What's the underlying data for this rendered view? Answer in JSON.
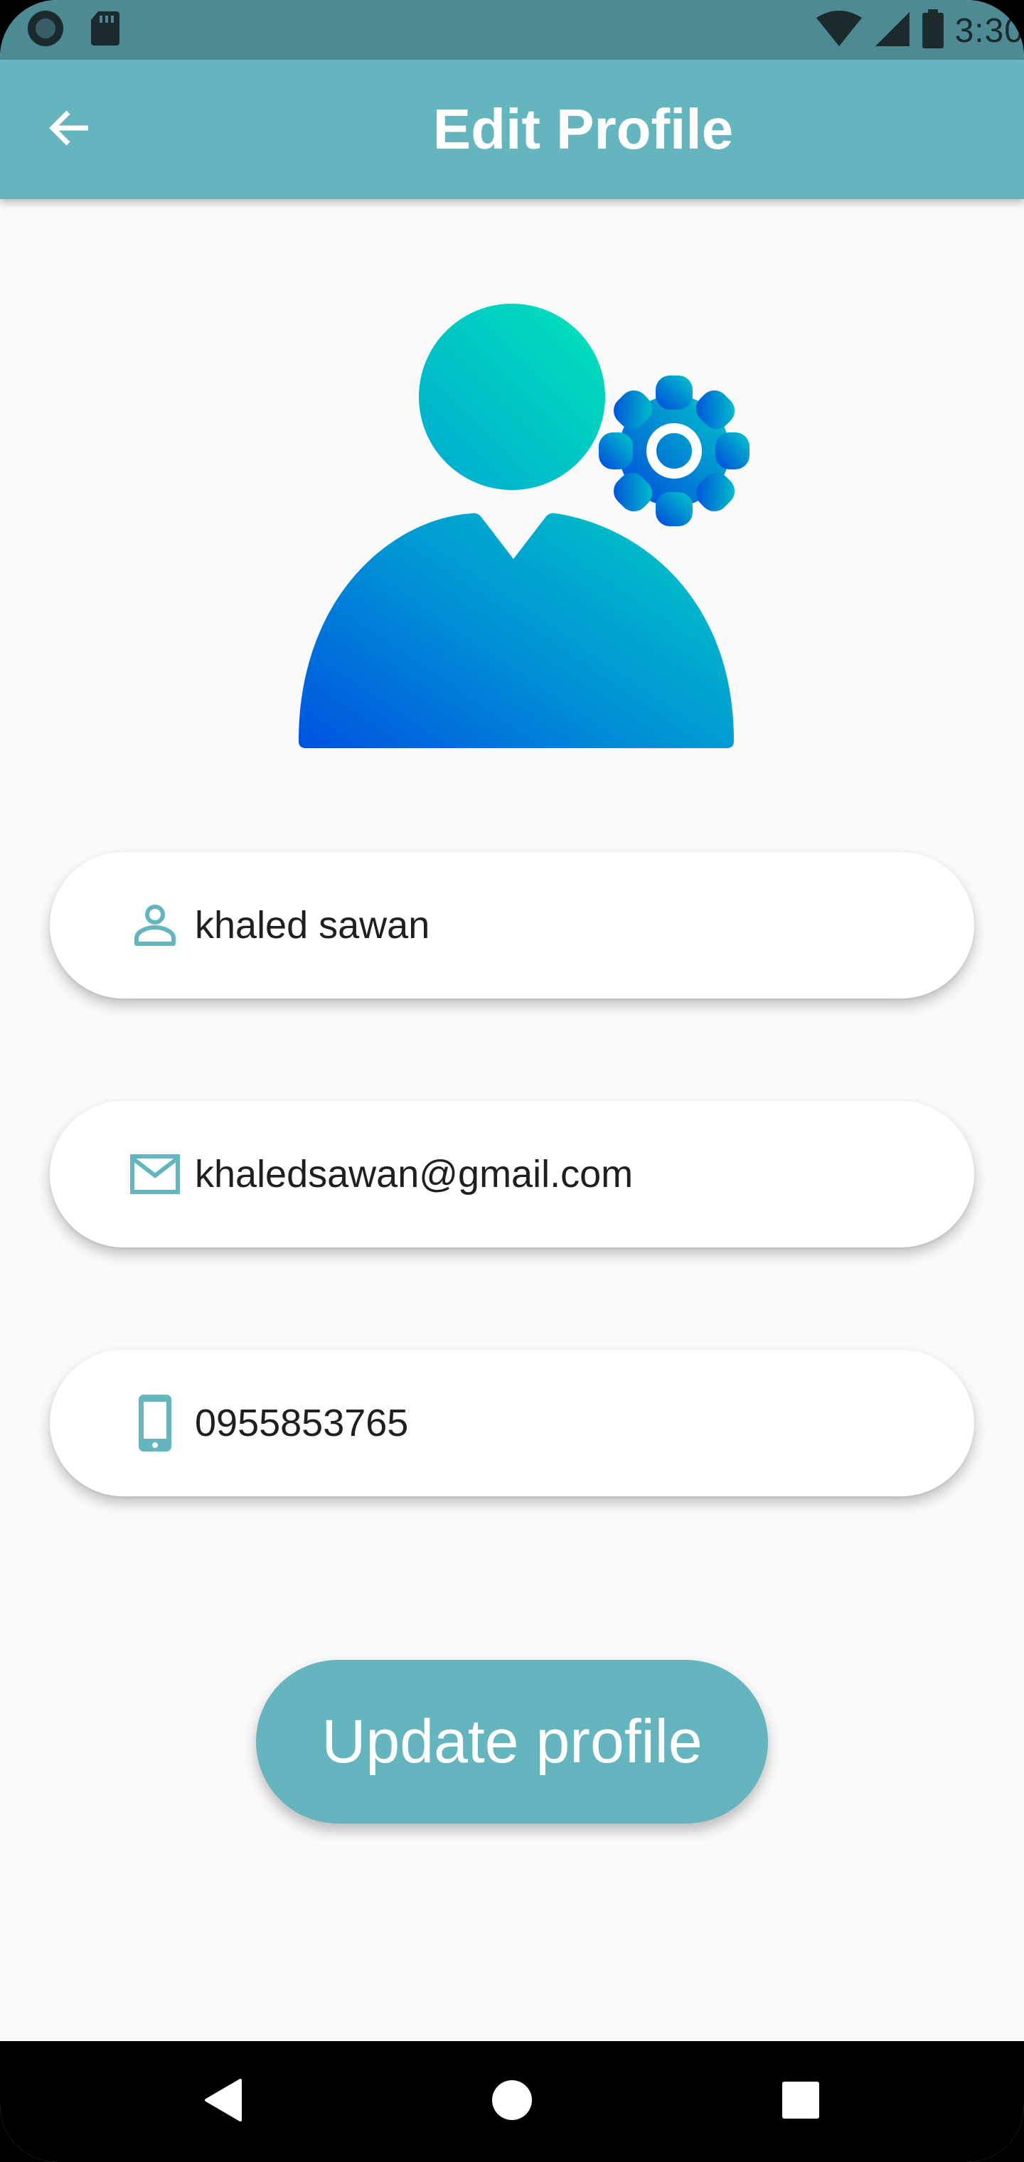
{
  "status_bar": {
    "time": "3:30",
    "icons": [
      "recording-icon",
      "sd-card-icon",
      "wifi-icon",
      "signal-icon",
      "battery-icon"
    ]
  },
  "app_bar": {
    "title": "Edit Profile",
    "back_icon": "arrow-back-icon"
  },
  "avatar": {
    "icon": "user-settings-icon",
    "gradient_start": "#0051DF",
    "gradient_end": "#00E0B8"
  },
  "fields": {
    "name": {
      "icon": "person-icon",
      "value": "khaled sawan"
    },
    "email": {
      "icon": "mail-icon",
      "value": "khaledsawan@gmail.com"
    },
    "phone": {
      "icon": "phone-icon",
      "value": "0955853765"
    }
  },
  "update_button": {
    "label": "Update profile"
  },
  "nav_bar": {
    "back": "nav-back-icon",
    "home": "nav-home-icon",
    "recents": "nav-recents-icon"
  },
  "colors": {
    "accent": "#65B5BF",
    "status_bar": "#4E8A93",
    "background": "#FAFAFA"
  }
}
